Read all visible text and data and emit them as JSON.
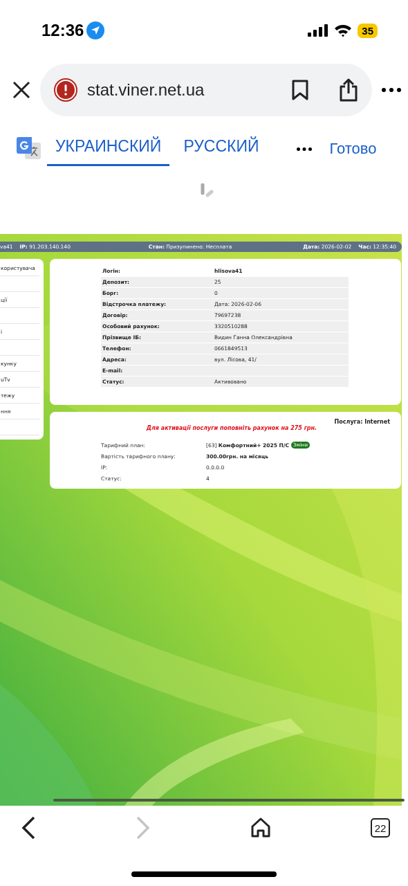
{
  "status_bar": {
    "time": "12:36",
    "battery": "35"
  },
  "browser": {
    "url": "stat.viner.net.ua",
    "tabs_count": "22",
    "forward_disabled": true
  },
  "translate_bar": {
    "languages": [
      {
        "label": "УКРАИНСКИЙ",
        "selected": true
      },
      {
        "label": "РУССКИЙ",
        "selected": false
      }
    ],
    "done": "Готово"
  },
  "page": {
    "header": {
      "login_fragment": "va41",
      "ip_label": "IP:",
      "ip": "91.203.140.140",
      "state_label": "Стан:",
      "state": "Призупинено: Несплата",
      "date_label": "Дата:",
      "date": "2026-02-02",
      "time_label": "Час:",
      "time": "12:35:40"
    },
    "sidebar": {
      "items": [
        {
          "kind": "text",
          "label": "користувача"
        },
        {
          "kind": "empty"
        },
        {
          "kind": "text",
          "label": "ції"
        },
        {
          "kind": "empty"
        },
        {
          "kind": "text",
          "label": "і"
        },
        {
          "kind": "empty"
        },
        {
          "kind": "text",
          "label": "кунку"
        },
        {
          "kind": "text",
          "label": "uTv"
        },
        {
          "kind": "text",
          "label": "тежу"
        },
        {
          "kind": "text",
          "label": "ння"
        },
        {
          "kind": "empty"
        }
      ]
    },
    "account": {
      "rows": [
        {
          "label": "Логін:",
          "value": "hlisova41",
          "kind": "head"
        },
        {
          "label": "Депозит:",
          "value": "25",
          "kind": "plain"
        },
        {
          "label": "Борг:",
          "value": "0",
          "kind": "plain"
        },
        {
          "label": "Відстрочка платежу:",
          "value": "Дата: 2026-02-06",
          "kind": "plain"
        },
        {
          "label": "Договір:",
          "value": "79697238",
          "kind": "plain"
        },
        {
          "label": "Особовий рахунок:",
          "value": "3320510288",
          "kind": "plain"
        },
        {
          "label": "Прізвище ІБ:",
          "value": "Видин Ганна Олександрівна",
          "kind": "plain"
        },
        {
          "label": "Телефон:",
          "value": "0661849513",
          "kind": "plain"
        },
        {
          "label": "Адреса:",
          "value": "вул. Лісова, 41/",
          "kind": "plain"
        },
        {
          "label": "E-mail:",
          "kind": "plain"
        },
        {
          "label": "Статус:",
          "value": "Активовано",
          "kind": "plain"
        }
      ]
    },
    "service": {
      "title": "Послуга: Internet",
      "warning": "Для активації послуги поповніть рахунок на 275 грн.",
      "rows": [
        {
          "label": "Тарифний план:",
          "value": "[63] **Комфортний+ 2025 П/С**",
          "button": "Зміни",
          "kind": "plain"
        },
        {
          "label": "Вартість тарифного плану:",
          "value": "300.00грн. на місяць",
          "kind": "bold"
        },
        {
          "label": "IP:",
          "value": "0.0.0.0",
          "kind": "plain"
        },
        {
          "label": "Статус:",
          "value": "4",
          "kind": "plain"
        }
      ]
    }
  }
}
